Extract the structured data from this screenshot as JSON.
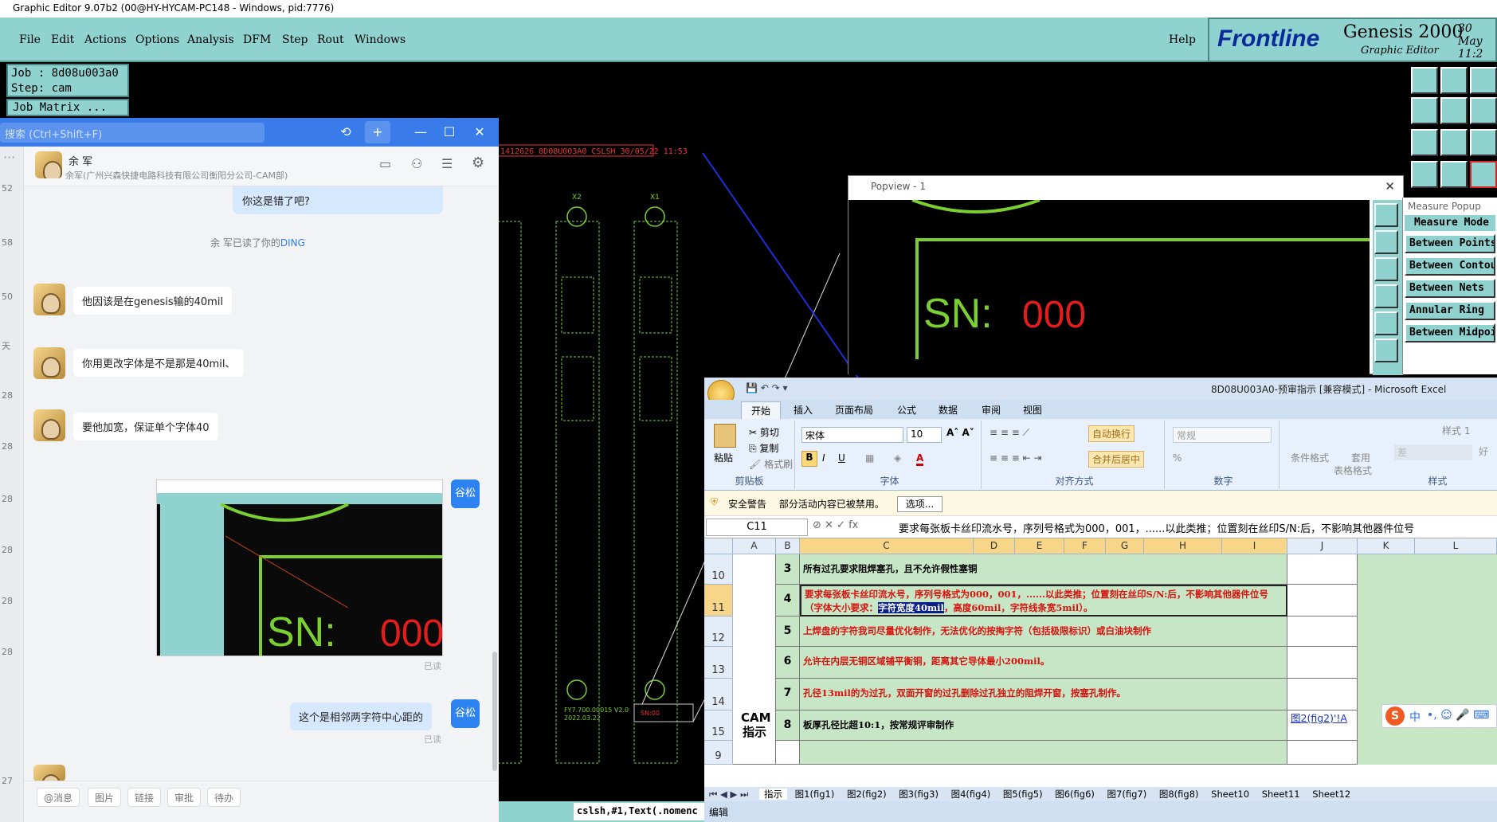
{
  "genesis": {
    "window_title": "Graphic Editor 9.07b2 (00@HY-HYCAM-PC148 - Windows, pid:7776)",
    "menu": [
      "File",
      "Edit",
      "Actions",
      "Options",
      "Analysis",
      "DFM",
      "Step",
      "Rout",
      "Windows"
    ],
    "help": "Help",
    "logo": {
      "brand": "Frontline",
      "product": "Genesis 2000",
      "subtitle": "Graphic Editor",
      "date": "30 May",
      "time": "11:2"
    },
    "job": "Job : 8d08u003a0",
    "step": "Step: cam",
    "job_matrix": "Job Matrix ...",
    "canvas_header": "1412626 8D08U003A0 CSLSH 30/05/22 11:53",
    "canvas_labels": {
      "x2": "X2",
      "x1": "X1",
      "stamp1": "FY7.700.00015 V2.0",
      "stamp2": "2022.03.22",
      "sn": "SN:00"
    },
    "status_cmd": "cslsh,#1,Text(.nomenc"
  },
  "popview": {
    "title": "Popview - 1",
    "sn_label": "SN:",
    "sn_value": "000"
  },
  "measure": {
    "title": "Measure Popup",
    "header": "Measure Mode",
    "buttons": [
      "Between Points",
      "Between Contours",
      "Between Nets",
      "Annular Ring",
      "Between Midpoints"
    ]
  },
  "chat": {
    "search_placeholder": "搜索 (Ctrl+Shift+F)",
    "contact_name": "余 军",
    "contact_org": "余军(广州兴森快捷电路科技有限公司衡阳分公司-CAM部)",
    "left_numbers": [
      "52",
      "58",
      "50",
      "天",
      "28",
      "28",
      "28",
      "28",
      "28",
      "28",
      "27"
    ],
    "messages": [
      {
        "from": "me",
        "text": "你这是错了吧?"
      },
      {
        "from": "system",
        "text": "余 军已读了你的",
        "link": "DING"
      },
      {
        "from": "other",
        "text": "他因该是在genesis输的40mil"
      },
      {
        "from": "other",
        "text": "你用更改字体是不是那是40mil、"
      },
      {
        "from": "other",
        "text": "要他加宽，保证单个字体40"
      },
      {
        "from": "me",
        "text": "这个是相邻两字符中心距的"
      }
    ],
    "my_avatar_label": "谷松",
    "read_label": "已读",
    "bottom_tags": [
      "@消息",
      "图片",
      "链接",
      "审批",
      "待办"
    ]
  },
  "excel": {
    "title": "8D08U003A0-预审指示 [兼容模式] - Microsoft Excel",
    "tabs": [
      "开始",
      "插入",
      "页面布局",
      "公式",
      "数据",
      "审阅",
      "视图"
    ],
    "clipboard": {
      "paste": "粘贴",
      "cut": "剪切",
      "copy": "复制",
      "painter": "格式刷",
      "name": "剪贴板"
    },
    "font": {
      "family": "宋体",
      "size": "10",
      "name": "字体",
      "bold": "B",
      "italic": "I",
      "underline": "U"
    },
    "align": {
      "wrap": "自动换行",
      "merge": "合并后居中",
      "name": "对齐方式"
    },
    "number": {
      "format": "常规",
      "name": "数字",
      "percent": "%"
    },
    "styles": {
      "cond": "条件格式",
      "apply": "套用",
      "table": "表格格式",
      "style1": "样式 1",
      "bad": "差",
      "good": "好",
      "name": "样式"
    },
    "security": {
      "label": "安全警告",
      "text": "部分活动内容已被禁用。",
      "options": "选项..."
    },
    "namebox": "C11",
    "formula": "要求每张板卡丝印流水号，序列号格式为000，001，......以此类推；位置刻在丝印S/N:后，不影响其他器件位号",
    "columns": [
      "A",
      "B",
      "C",
      "D",
      "E",
      "F",
      "G",
      "H",
      "I",
      "J",
      "K",
      "L"
    ],
    "rows": [
      {
        "row": "10",
        "b": "3",
        "c": "所有过孔要求阻焊塞孔，且不允许假性塞铜",
        "red": false
      },
      {
        "row": "11",
        "b": "4",
        "c1": "要求每张板卡丝印流水号，序列号格式为000，001，......以此类推；位置刻在丝印S/N:后，不影响其他器件位号（字体大小要求：",
        "hl": "字符宽度40mil",
        "c2": "，高度60mil，字符线条宽5mil）。",
        "red": true
      },
      {
        "row": "12",
        "b": "5",
        "c": "上焊盘的字符我司尽量优化制作，无法优化的按掏字符（包括极限标识）或白油块制作",
        "red": true
      },
      {
        "row": "13",
        "b": "6",
        "c": "允许在内层无铜区域铺平衡铜，距离其它导体最小200mil。",
        "red": true
      },
      {
        "row": "14",
        "b": "7",
        "c": "孔径13mil的为过孔，双面开窗的过孔删除过孔独立的阻焊开窗，按塞孔制作。",
        "red": true
      },
      {
        "row": "15",
        "b": "8",
        "c": "板厚孔径比超10:1，按常规评审制作",
        "red": false,
        "j": "图2(fig2)'!A"
      },
      {
        "row": "9",
        "b": "",
        "c": "",
        "red": false
      }
    ],
    "cam_label": "CAM指示",
    "sheets": [
      "指示",
      "图1(fig1)",
      "图2(fig2)",
      "图3(fig3)",
      "图4(fig4)",
      "图5(fig5)",
      "图6(fig6)",
      "图7(fig7)",
      "图8(fig8)",
      "Sheet10",
      "Sheet11",
      "Sheet12"
    ],
    "status": "编辑"
  },
  "ime": {
    "label": "中"
  }
}
